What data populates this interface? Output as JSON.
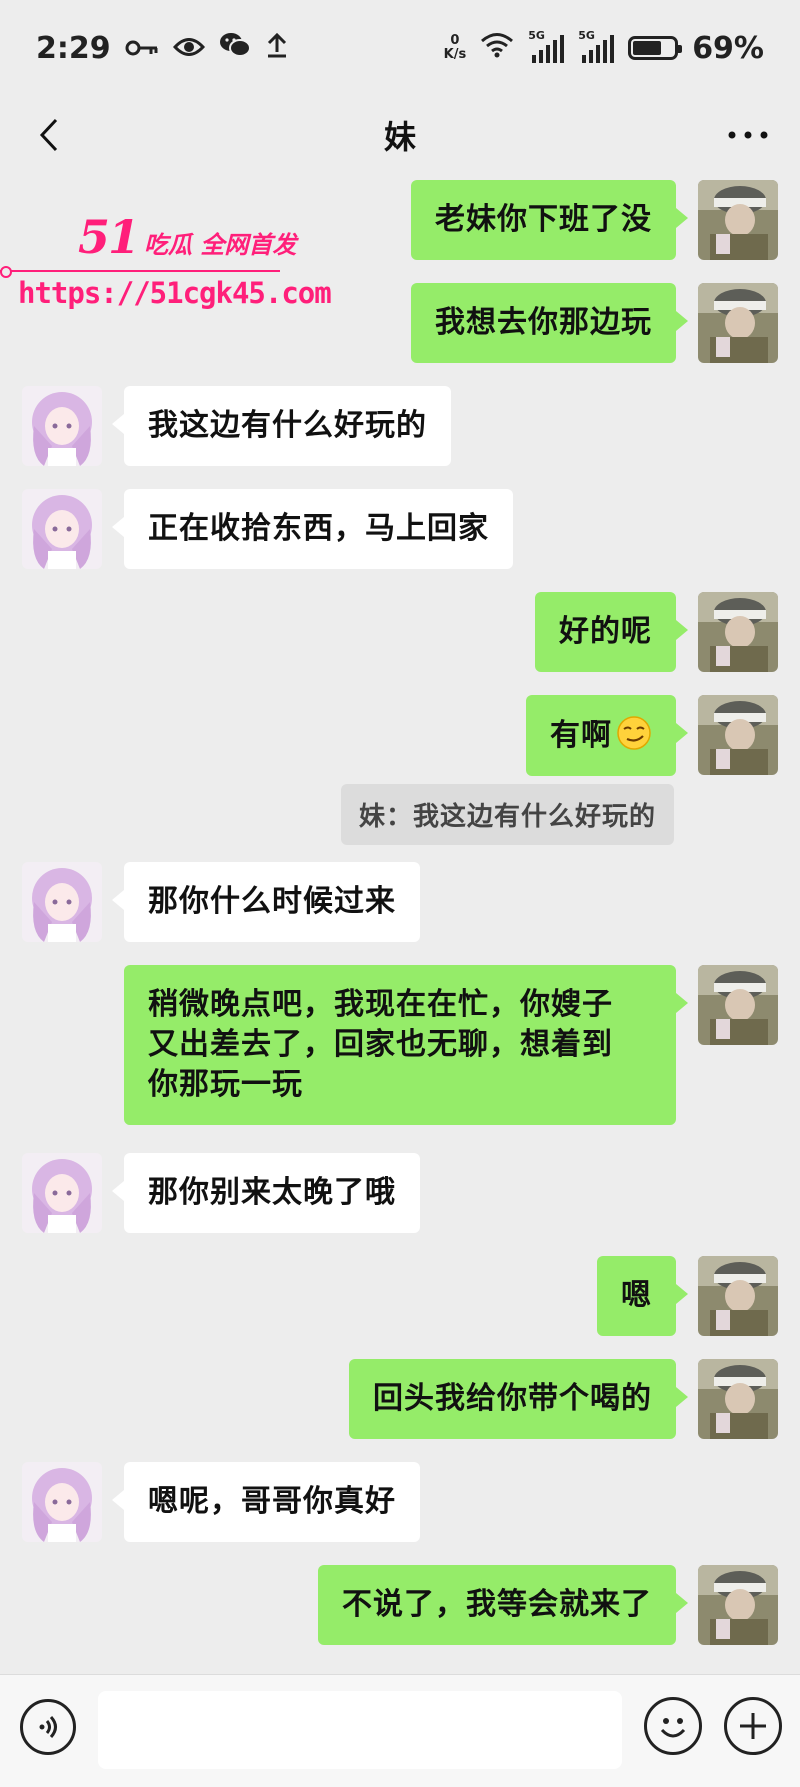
{
  "status_bar": {
    "time": "2:29",
    "net_speed_value": "0",
    "net_speed_unit": "K/s",
    "signal_1_label": "5G",
    "signal_2_label": "5G",
    "battery_text": "69%",
    "battery_level": 0.69,
    "icons": [
      "key-icon",
      "eye-icon",
      "wechat-icon",
      "upload-icon",
      "wifi-icon",
      "signal-icon",
      "battery-icon"
    ]
  },
  "header": {
    "title": "妹"
  },
  "watermark": {
    "brand_number": "51",
    "slogan": "吃瓜 全网首发",
    "url": "https://51cgk45.com"
  },
  "messages": [
    {
      "side": "right",
      "text": "老妹你下班了没"
    },
    {
      "side": "right",
      "text": "我想去你那边玩"
    },
    {
      "side": "left",
      "text": "我这边有什么好玩的"
    },
    {
      "side": "left",
      "text": "正在收拾东西，马上回家"
    },
    {
      "side": "right",
      "text": "好的呢"
    },
    {
      "side": "right",
      "text": "有啊",
      "emoji": "smirk-emoji"
    },
    {
      "side": "left",
      "text": "那你什么时候过来"
    },
    {
      "side": "right",
      "text_lines": [
        "稍微晚点吧，我现在在忙，你嫂子",
        "又出差去了，回家也无聊，想着到",
        "你那玩一玩"
      ]
    },
    {
      "side": "left",
      "text": "那你别来太晚了哦"
    },
    {
      "side": "right",
      "text": "嗯"
    },
    {
      "side": "right",
      "text": "回头我给你带个喝的"
    },
    {
      "side": "left",
      "text": "嗯呢，哥哥你真好"
    },
    {
      "side": "right",
      "text": "不说了，我等会就来了"
    }
  ],
  "quote": {
    "text": "妹：我这边有什么好玩的"
  },
  "input_bar": {
    "value": "",
    "icons": [
      "voice-icon",
      "emoji-icon",
      "plus-icon"
    ]
  }
}
